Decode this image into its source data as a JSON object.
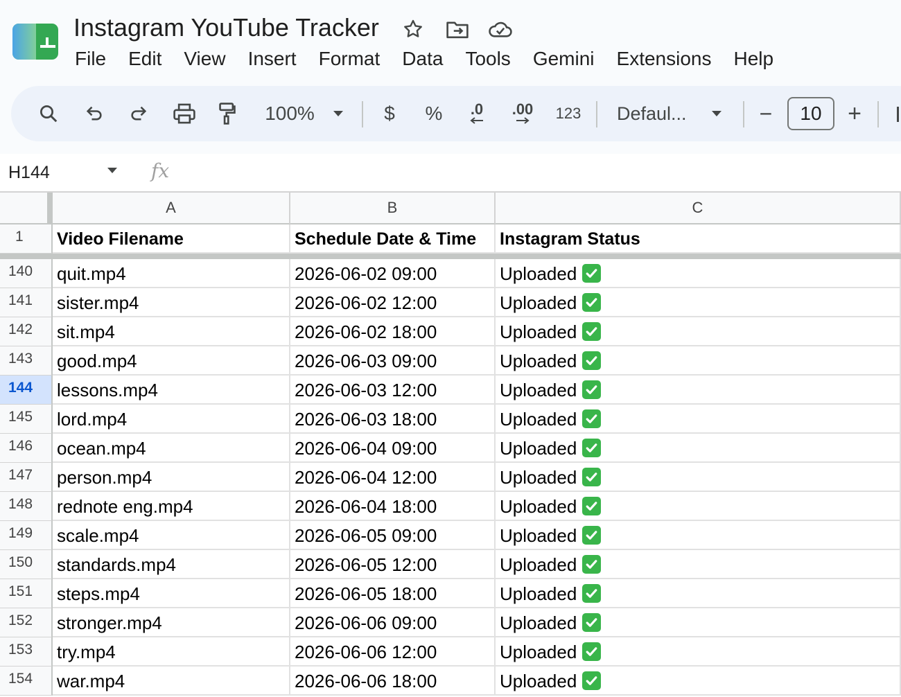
{
  "title_bar": {
    "doc_title": "Instagram YouTube Tracker"
  },
  "menu": [
    "File",
    "Edit",
    "View",
    "Insert",
    "Format",
    "Data",
    "Tools",
    "Gemini",
    "Extensions",
    "Help"
  ],
  "toolbar": {
    "zoom": "100%",
    "currency": "$",
    "percent": "%",
    "decrease_decimal": ".0",
    "increase_decimal": ".00",
    "number_format": "123",
    "font_family": "Defaul...",
    "font_size": "10",
    "minus": "−",
    "plus": "+"
  },
  "formula_bar": {
    "cell_ref": "H144",
    "fx": "fx"
  },
  "sheet": {
    "columns": [
      "A",
      "B",
      "C"
    ],
    "header_row_number": "1",
    "headers": [
      "Video Filename",
      "Schedule Date & Time",
      "Instagram Status"
    ],
    "selected_row": "144",
    "rows": [
      {
        "num": "140",
        "filename": "quit.mp4",
        "schedule": "2026-06-02 09:00",
        "status": "Uploaded"
      },
      {
        "num": "141",
        "filename": "sister.mp4",
        "schedule": "2026-06-02 12:00",
        "status": "Uploaded"
      },
      {
        "num": "142",
        "filename": "sit.mp4",
        "schedule": "2026-06-02 18:00",
        "status": "Uploaded"
      },
      {
        "num": "143",
        "filename": "good.mp4",
        "schedule": "2026-06-03 09:00",
        "status": "Uploaded"
      },
      {
        "num": "144",
        "filename": "lessons.mp4",
        "schedule": "2026-06-03 12:00",
        "status": "Uploaded"
      },
      {
        "num": "145",
        "filename": "lord.mp4",
        "schedule": "2026-06-03 18:00",
        "status": "Uploaded"
      },
      {
        "num": "146",
        "filename": "ocean.mp4",
        "schedule": "2026-06-04 09:00",
        "status": "Uploaded"
      },
      {
        "num": "147",
        "filename": "person.mp4",
        "schedule": "2026-06-04 12:00",
        "status": "Uploaded"
      },
      {
        "num": "148",
        "filename": "rednote eng.mp4",
        "schedule": "2026-06-04 18:00",
        "status": "Uploaded"
      },
      {
        "num": "149",
        "filename": "scale.mp4",
        "schedule": "2026-06-05 09:00",
        "status": "Uploaded"
      },
      {
        "num": "150",
        "filename": "standards.mp4",
        "schedule": "2026-06-05 12:00",
        "status": "Uploaded"
      },
      {
        "num": "151",
        "filename": "steps.mp4",
        "schedule": "2026-06-05 18:00",
        "status": "Uploaded"
      },
      {
        "num": "152",
        "filename": "stronger.mp4",
        "schedule": "2026-06-06 09:00",
        "status": "Uploaded"
      },
      {
        "num": "153",
        "filename": "try.mp4",
        "schedule": "2026-06-06 12:00",
        "status": "Uploaded"
      },
      {
        "num": "154",
        "filename": "war.mp4",
        "schedule": "2026-06-06 18:00",
        "status": "Uploaded"
      }
    ]
  },
  "icons": {
    "status_check": "check-mark-button-icon",
    "status_check_color": "#39b54a"
  }
}
